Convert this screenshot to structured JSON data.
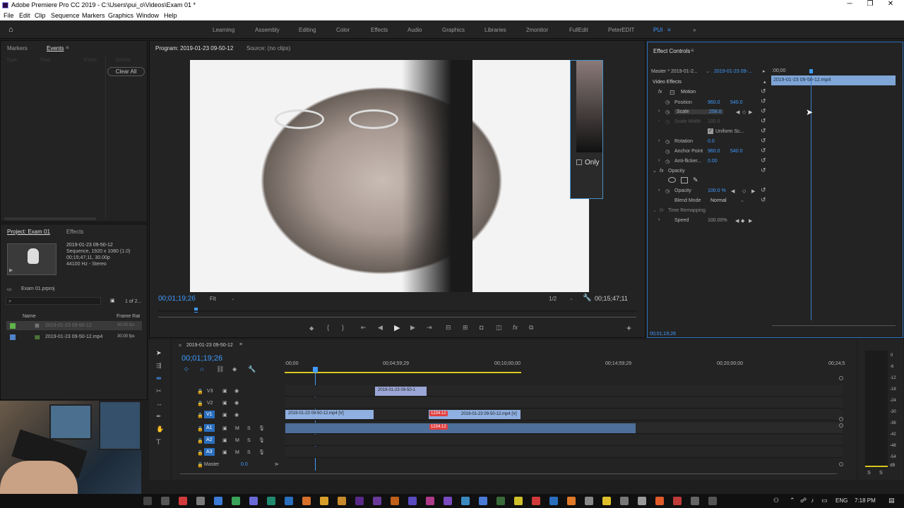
{
  "window": {
    "title": "Adobe Premiere Pro CC 2019 - C:\\Users\\pui_o\\Videos\\Exam 01 *",
    "minimize": "─",
    "restore": "❐",
    "close": "✕"
  },
  "menu": [
    "File",
    "Edit",
    "Clip",
    "Sequence",
    "Markers",
    "Graphics",
    "Window",
    "Help"
  ],
  "workspaces": [
    "Learning",
    "Assembly",
    "Editing",
    "Color",
    "Effects",
    "Audio",
    "Graphics",
    "Libraries",
    "2monitor",
    "FullEdit",
    "PeterEDIT",
    "PUI",
    "≡",
    "»"
  ],
  "markers_panel": {
    "tabs": [
      "Markers",
      "Events"
    ],
    "cols": [
      "Type",
      "Time",
      "Event",
      "Details"
    ],
    "clear_all": "Clear All"
  },
  "project_panel": {
    "tabs": [
      "Project: Exam 01",
      "Effects"
    ],
    "clip_info": [
      "2019-01-23 09-50-12",
      "Sequence, 1920 x 1080 (1.0)",
      "00;15;47;11, 30.00p",
      "44100 Hz - Stereo"
    ],
    "project_file": "Exam 01.prproj",
    "items_count": "1 of 2...",
    "cols": [
      "Name",
      "Frame Rat"
    ],
    "items": [
      {
        "name": "2019-01-23 09-50-12",
        "rate": "30.00 fps",
        "color": "#5fb54a"
      },
      {
        "name": "2019-01-23 09-50-12.mp4",
        "rate": "30.00 fps",
        "color": "#4f83c9"
      }
    ]
  },
  "program": {
    "tabs": [
      "Program: 2019-01-23 09-50-12",
      "Source: (no clips)"
    ],
    "timecode": "00;01;19;26",
    "fit": "Fit",
    "resolution": "1/2",
    "duration": "00;15;47;11",
    "overlay_text": "Only"
  },
  "effect_controls": {
    "tab": "Effect Controls",
    "master": "Master * 2019-01-2...",
    "sequence": "2019-01-23 09-...",
    "ruler_start": ":00;00",
    "clip_label": "2019-01-23 09-50-12.mp4",
    "video_effects": "Video Effects",
    "motion": "Motion",
    "params": [
      {
        "label": "Position",
        "v1": "960.0",
        "v2": "540.0"
      },
      {
        "label": "Scale",
        "v1": "258.0",
        "v2": ""
      },
      {
        "label": "Scale Width",
        "v1": "100.0",
        "v2": ""
      },
      {
        "label": "Rotation",
        "v1": "0.0",
        "v2": ""
      },
      {
        "label": "Anchor Point",
        "v1": "960.0",
        "v2": "540.0"
      },
      {
        "label": "Anti-flicker...",
        "v1": "0.00",
        "v2": ""
      }
    ],
    "uniform_scale": "Uniform Sc...",
    "opacity_group": "Opacity",
    "opacity": {
      "label": "Opacity",
      "value": "100.0 %"
    },
    "blend": {
      "label": "Blend Mode",
      "value": "Normal"
    },
    "time_remap": "Time Remapping",
    "speed": {
      "label": "Speed",
      "value": "100.00%"
    },
    "timecode": "00;01;19;26"
  },
  "timeline": {
    "sequence_tab": "2019-01-23 09-50-12",
    "timecode": "00;01;19;26",
    "ruler": [
      ":00;00",
      "00;04;59;29",
      "00;10;00;00",
      "00;14;59;29",
      "00;20;00;00",
      "00;24;5"
    ],
    "tracks_video": [
      "V3",
      "V2",
      "V1"
    ],
    "tracks_audio": [
      "A1",
      "A2",
      "A3"
    ],
    "master": "Master",
    "master_val": "0.0",
    "clips": {
      "v2": "2019-01-23 09-50-1",
      "v1a": "2019-01-23 09-50-12.mp4 [V]",
      "v1b": "2019-01-23 09-50-12.mp4 [V]",
      "v1b_badge": "1234.12",
      "a1_badge": "1234.12"
    }
  },
  "meter": {
    "scale": [
      "0",
      "-6",
      "-12",
      "-18",
      "-24",
      "-30",
      "-36",
      "-42",
      "-48",
      "-54",
      "dB"
    ],
    "solo": [
      "S",
      "S"
    ]
  },
  "taskbar": {
    "lang": "ENG",
    "time": "7:18 PM"
  }
}
